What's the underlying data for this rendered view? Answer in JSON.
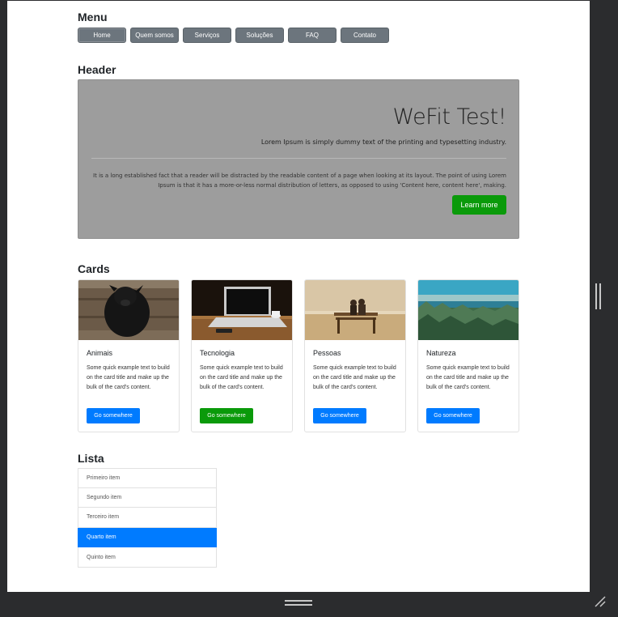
{
  "menu": {
    "title": "Menu",
    "items": [
      {
        "label": "Home"
      },
      {
        "label": "Quem somos"
      },
      {
        "label": "Serviços"
      },
      {
        "label": "Soluções"
      },
      {
        "label": "FAQ"
      },
      {
        "label": "Contato"
      }
    ]
  },
  "header": {
    "title": "Header",
    "jumbotron": {
      "heading": "WeFit Test!",
      "lead": "Lorem Ipsum is simply dummy text of the printing and typesetting industry.",
      "body": "It is a long established fact that a reader will be distracted by the readable content of a page when looking at its layout. The point of using Lorem Ipsum is that it has a more-or-less normal distribution of letters, as opposed to using 'Content here, content here', making.",
      "button": "Learn more",
      "button_color": "#0a9a0a"
    }
  },
  "cards": {
    "title": "Cards",
    "items": [
      {
        "title": "Animais",
        "text": "Some quick example text to build on the card title and make up the bulk of the card's content.",
        "button": "Go somewhere",
        "button_color": "#007bff",
        "image": "black-dog-photo"
      },
      {
        "title": "Tecnologia",
        "text": "Some quick example text to build on the card title and make up the bulk of the card's content.",
        "button": "Go somewhere",
        "button_color": "#0a9a0a",
        "image": "laptop-on-desk-photo"
      },
      {
        "title": "Pessoas",
        "text": "Some quick example text to build on the card title and make up the bulk of the card's content.",
        "button": "Go somewhere",
        "button_color": "#007bff",
        "image": "couple-on-bench-photo"
      },
      {
        "title": "Natureza",
        "text": "Some quick example text to build on the card title and make up the bulk of the card's content.",
        "button": "Go somewhere",
        "button_color": "#007bff",
        "image": "lake-and-trees-photo"
      }
    ]
  },
  "list": {
    "title": "Lista",
    "items": [
      {
        "label": "Primeiro item"
      },
      {
        "label": "Segundo item"
      },
      {
        "label": "Terceiro item"
      },
      {
        "label": "Quarto item",
        "active": true
      },
      {
        "label": "Quinto item"
      }
    ],
    "active_color": "#007bff"
  }
}
